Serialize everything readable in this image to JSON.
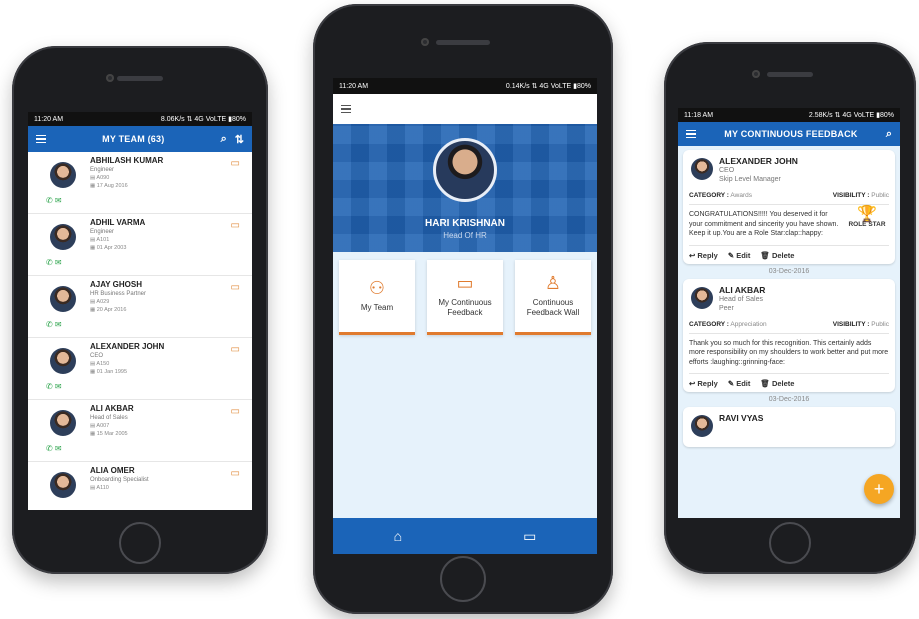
{
  "phone1": {
    "status": {
      "time": "11:20 AM",
      "info": "8.06K/s ⇅ 4G VoLTE ▮80%"
    },
    "appbar": {
      "title": "MY TEAM (63)"
    },
    "team": [
      {
        "name": "ABHILASH KUMAR",
        "role": "Engineer",
        "id": "A090",
        "date": "17 Aug 2016"
      },
      {
        "name": "ADHIL VARMA",
        "role": "Engineer",
        "id": "A101",
        "date": "01 Apr 2003"
      },
      {
        "name": "AJAY GHOSH",
        "role": "HR Business Partner",
        "id": "A029",
        "date": "20 Apr 2016"
      },
      {
        "name": "ALEXANDER JOHN",
        "role": "CEO",
        "id": "A150",
        "date": "01 Jan 1995"
      },
      {
        "name": "ALI AKBAR",
        "role": "Head of Sales",
        "id": "A007",
        "date": "15 Mar 2005"
      },
      {
        "name": "ALIA OMER",
        "role": "Onboarding Specialist",
        "id": "A110",
        "date": ""
      }
    ]
  },
  "phone2": {
    "status": {
      "time": "11:20 AM",
      "info": "0.14K/s ⇅ 4G VoLTE ▮80%"
    },
    "profile": {
      "name": "HARI KRISHNAN",
      "title": "Head Of HR"
    },
    "tiles": [
      {
        "label": "My Team"
      },
      {
        "label": "My Continuous Feedback"
      },
      {
        "label": "Continuous Feedback Wall"
      }
    ]
  },
  "phone3": {
    "status": {
      "time": "11:18 AM",
      "info": "2.58K/s ⇅ 4G VoLTE ▮80%"
    },
    "appbar": {
      "title": "MY CONTINUOUS FEEDBACK"
    },
    "category_label": "CATEGORY :",
    "visibility_label": "VISIBILITY :",
    "actions": {
      "reply": "Reply",
      "edit": "Edit",
      "delete": "Delete"
    },
    "cards": [
      {
        "name": "ALEXANDER JOHN",
        "title": "CEO",
        "relation": "Skip Level Manager",
        "category": "Awards",
        "visibility": "Public",
        "message": "CONGRATULATIONS!!!!! You deserved it for your commitment and sincerity you have shown. Keep it up.You are a Role Star:clap::happy:",
        "badge": "ROLE STAR",
        "date": "03-Dec-2016"
      },
      {
        "name": "ALI AKBAR",
        "title": "Head of Sales",
        "relation": "Peer",
        "category": "Appreciation",
        "visibility": "Public",
        "message": "Thank you so much for this recognition. This certainly adds more responsibility on my shoulders to work better and put more efforts :laughing::grinning-face:",
        "date": "03-Dec-2016"
      }
    ],
    "next_name": "RAVI VYAS"
  }
}
